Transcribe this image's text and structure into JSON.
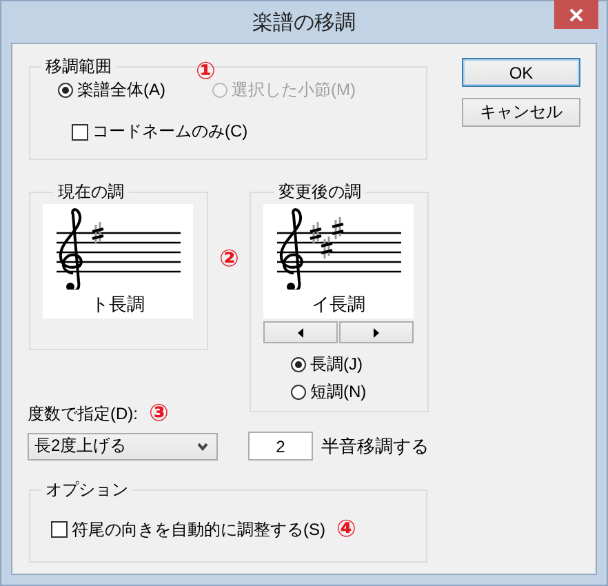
{
  "window": {
    "title": "楽譜の移調"
  },
  "range_group": {
    "title": "移調範囲",
    "marker": "①",
    "options": [
      {
        "label": "楽譜全体(A)",
        "selected": true,
        "disabled": false
      },
      {
        "label": "選択した小節(M)",
        "selected": false,
        "disabled": true
      }
    ],
    "chord_names_only": {
      "label": "コードネームのみ(C)",
      "checked": false
    }
  },
  "keys": {
    "marker": "②",
    "current": {
      "title": "現在の調",
      "key": "ト長調",
      "kind": "one_sharp"
    },
    "target": {
      "title": "変更後の調",
      "key": "イ長調",
      "kind": "three_sharps",
      "modes": [
        {
          "label": "長調(J)",
          "selected": true
        },
        {
          "label": "短調(N)",
          "selected": false
        }
      ]
    }
  },
  "interval": {
    "label": "度数で指定(D):",
    "marker": "③",
    "value": "長2度上げる",
    "semitones": "2",
    "semitones_label": "半音移調する"
  },
  "options_group": {
    "title": "オプション",
    "marker": "④",
    "auto_stem": {
      "label": "符尾の向きを自動的に調整する(S)",
      "checked": false
    }
  },
  "buttons": [
    {
      "label": "OK",
      "default": true
    },
    {
      "label": "キャンセル",
      "default": false
    }
  ]
}
